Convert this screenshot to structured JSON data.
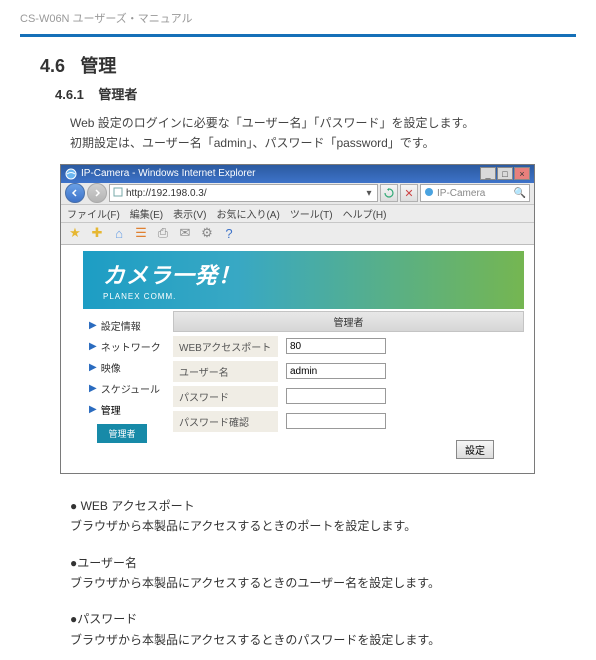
{
  "doc": {
    "product_header": "CS-W06N ユーザーズ・マニュアル",
    "section_number": "4.6",
    "section_title": "管理",
    "subsection_number": "4.6.1",
    "subsection_title": "管理者",
    "intro_line1": "Web 設定のログインに必要な「ユーザー名」「パスワード」を設定します。",
    "intro_line2": "初期設定は、ユーザー名「admin」、パスワード「password」です。"
  },
  "browser": {
    "title": "IP-Camera - Windows Internet Explorer",
    "address": "http://192.198.0.3/",
    "search_engine": "IP-Camera",
    "menu": {
      "file": "ファイル(F)",
      "edit": "編集(E)",
      "view": "表示(V)",
      "favorites": "お気に入り(A)",
      "tools": "ツール(T)",
      "help": "ヘルプ(H)"
    }
  },
  "page": {
    "banner_main": "カメラ一発！",
    "banner_sub": "PLANEX COMM.",
    "sidebar": {
      "items": [
        {
          "label": "設定情報"
        },
        {
          "label": "ネットワーク"
        },
        {
          "label": "映像"
        },
        {
          "label": "スケジュール"
        },
        {
          "label": "管理"
        }
      ],
      "sub_active": "管理者"
    },
    "panel_title": "管理者",
    "form": {
      "rows": [
        {
          "label": "WEBアクセスポート",
          "value": "80"
        },
        {
          "label": "ユーザー名",
          "value": "admin"
        },
        {
          "label": "パスワード",
          "value": ""
        },
        {
          "label": "パスワード確認",
          "value": ""
        }
      ],
      "submit": "設定"
    }
  },
  "descriptions": {
    "d1_head": "● WEB アクセスポート",
    "d1_body": "ブラウザから本製品にアクセスするときのポートを設定します。",
    "d2_head": "●ユーザー名",
    "d2_body": "ブラウザから本製品にアクセスするときのユーザー名を設定します。",
    "d3_head": "●パスワード",
    "d3_body": "ブラウザから本製品にアクセスするときのパスワードを設定します。"
  }
}
